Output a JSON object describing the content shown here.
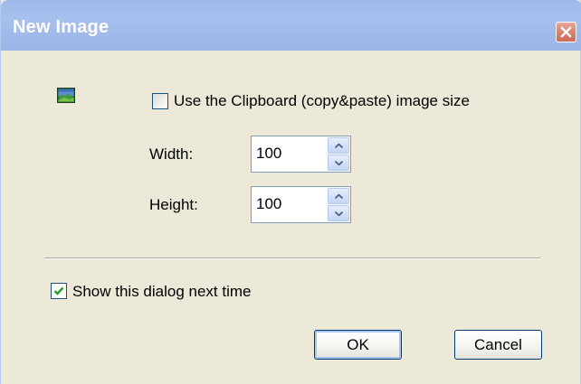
{
  "window": {
    "title": "New Image",
    "close_icon": "close-icon"
  },
  "image_icon": "image-icon",
  "clipboard_option": {
    "label": "Use the Clipboard (copy&paste) image size",
    "checked": false
  },
  "width": {
    "label": "Width:",
    "value": "100"
  },
  "height": {
    "label": "Height:",
    "value": "100"
  },
  "show_dialog_option": {
    "label": "Show this dialog next time",
    "checked": true
  },
  "buttons": {
    "ok": "OK",
    "cancel": "Cancel"
  },
  "colors": {
    "title_bar": "#9fb8e8",
    "dialog_bg": "#ece9d8",
    "close_button": "#d9826f",
    "checkmark": "#21a121"
  }
}
